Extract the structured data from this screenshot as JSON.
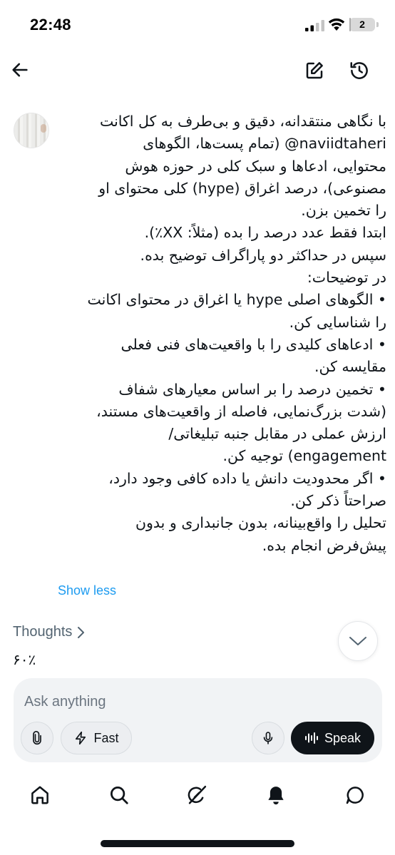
{
  "status_bar": {
    "time": "22:48",
    "battery_level": "2",
    "battery_fraction": 0.02
  },
  "header": {
    "back_icon": "arrow-left-icon",
    "edit_icon": "edit-icon",
    "history_icon": "history-icon"
  },
  "prompt": {
    "lines": [
      "با نگاهی منتقدانه، دقیق و بی‌طرف به کل اکانت",
      "naviidtaheri@ (تمام پست‌ها، الگوهای",
      "محتوایی، ادعاها و سبک کلی در حوزه هوش",
      "مصنوعی)، درصد اغراق (hype) کلی محتوای او",
      "را تخمین بزن.",
      "ابتدا فقط عدد درصد را بده (مثلاً: XX٪).",
      "سپس در حداکثر دو پاراگراف توضیح بده.",
      "در توضیحات:",
      "•  الگوهای اصلی hype یا اغراق در محتوای اکانت",
      "را شناسایی کن.",
      "•  ادعاهای کلیدی را با واقعیت‌های فنی فعلی",
      "مقایسه کن.",
      "•  تخمین درصد را بر اساس معیارهای شفاف",
      "(شدت بزرگ‌نمایی، فاصله از واقعیت‌های مستند،",
      "ارزش عملی در مقابل جنبه تبلیغاتی/",
      "engagement) توجیه کن.",
      "•  اگر محدودیت دانش یا داده کافی وجود دارد،",
      "صراحتاً ذکر کن.",
      "تحلیل را واقع‌بینانه، بدون جانبداری و بدون",
      "پیش‌فرض انجام بده."
    ],
    "show_less_label": "Show less"
  },
  "reply": {
    "thoughts_label": "Thoughts",
    "answer": "۶۰٪"
  },
  "composer": {
    "placeholder": "Ask anything",
    "fast_label": "Fast",
    "speak_label": "Speak"
  },
  "bottom_nav": {
    "items": [
      "home-icon",
      "search-icon",
      "grok-icon",
      "notifications-icon",
      "messages-icon"
    ]
  },
  "colors": {
    "link": "#1d9bf0",
    "text": "#0f1419",
    "muted": "#536471",
    "composer_bg": "#f1f3f5",
    "speak_bg": "#0f1419"
  }
}
